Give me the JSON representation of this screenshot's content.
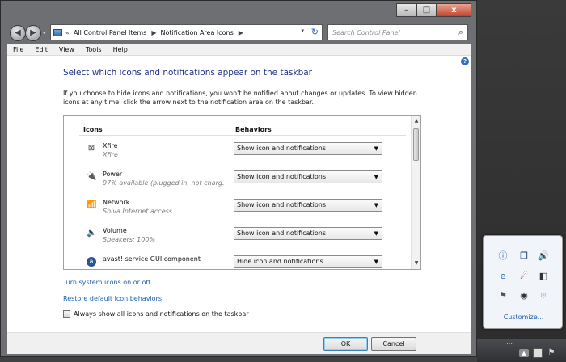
{
  "window": {
    "captions": {
      "minimize": "–",
      "maximize": "□",
      "close": "x"
    }
  },
  "nav": {
    "back_icon": "◀",
    "forward_icon": "▶",
    "dropdown_icon": "▾",
    "breadcrumb_sep": "«",
    "breadcrumbs": [
      "All Control Panel Items",
      "Notification Area Icons"
    ],
    "arrow_icon": "▶",
    "address_dropdown": "▾",
    "refresh_icon": "↻",
    "search_placeholder": "Search Control Panel",
    "search_icon": "⌕"
  },
  "menu": [
    "File",
    "Edit",
    "View",
    "Tools",
    "Help"
  ],
  "help_icon": "?",
  "heading": "Select which icons and notifications appear on the taskbar",
  "intro": "If you choose to hide icons and notifications, you won't be notified about changes or updates. To view hidden icons at any time, click the arrow next to the notification area on the taskbar.",
  "list": {
    "col_icons": "Icons",
    "col_behaviors": "Behaviors",
    "items": [
      {
        "icon": "xfire-icon",
        "glyph": "⊠",
        "name": "Xfire",
        "desc": "Xfire",
        "behavior": "Show icon and notifications"
      },
      {
        "icon": "power-icon",
        "glyph": "🔌",
        "name": "Power",
        "desc": "97% available (plugged in, not charg...",
        "behavior": "Show icon and notifications"
      },
      {
        "icon": "network-icon",
        "glyph": "📶",
        "name": "Network",
        "desc": "Shiva Internet access",
        "behavior": "Show icon and notifications"
      },
      {
        "icon": "volume-icon",
        "glyph": "🔈",
        "name": "Volume",
        "desc": "Speakers: 100%",
        "behavior": "Show icon and notifications"
      },
      {
        "icon": "avast-icon",
        "glyph": "a",
        "name": "avast! service GUI component",
        "desc": "",
        "behavior": "Hide icon and notifications"
      }
    ],
    "caret": "▼",
    "scroll_up": "▲",
    "scroll_down": "▼"
  },
  "links": {
    "system_icons": "Turn system icons on or off",
    "restore": "Restore default icon behaviors"
  },
  "checkbox": {
    "label": "Always show all icons and notifications on the taskbar",
    "checked": false
  },
  "buttons": {
    "ok": "OK",
    "cancel": "Cancel"
  },
  "flyout": {
    "icons": [
      {
        "name": "info-icon",
        "glyph": "ⓘ"
      },
      {
        "name": "dropbox-icon",
        "glyph": "❒"
      },
      {
        "name": "speaker-icon",
        "glyph": "🔊"
      },
      {
        "name": "ie-icon",
        "glyph": "e"
      },
      {
        "name": "ccleaner-icon",
        "glyph": "☄"
      },
      {
        "name": "tray-app-icon",
        "glyph": "◧"
      },
      {
        "name": "action-center-flag-icon",
        "glyph": "⚑"
      },
      {
        "name": "steam-icon",
        "glyph": "◉"
      },
      {
        "name": "wifi-tray-icon",
        "glyph": "⌾"
      }
    ],
    "customize": "Customize..."
  },
  "taskbar": {
    "show_hidden_icon": "▲",
    "dots": "⋯"
  }
}
